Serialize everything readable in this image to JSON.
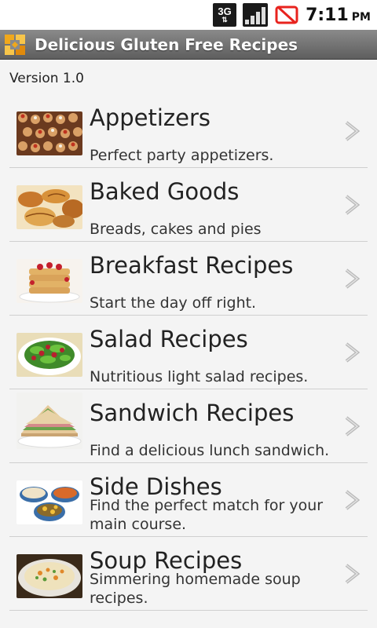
{
  "status_bar": {
    "network": "3G",
    "time": "7:11",
    "ampm": "PM"
  },
  "title_bar": {
    "title": "Delicious Gluten Free Recipes"
  },
  "version": "Version 1.0",
  "categories": [
    {
      "title": "Appetizers",
      "subtitle": "Perfect party appetizers."
    },
    {
      "title": "Baked Goods",
      "subtitle": "Breads, cakes and pies"
    },
    {
      "title": "Breakfast Recipes",
      "subtitle": "Start the day off right."
    },
    {
      "title": "Salad Recipes",
      "subtitle": "Nutritious light salad recipes."
    },
    {
      "title": "Sandwich Recipes",
      "subtitle": "Find a delicious lunch sandwich."
    },
    {
      "title": "Side Dishes",
      "subtitle": "Find the perfect match for your main course."
    },
    {
      "title": "Soup Recipes",
      "subtitle": "Simmering homemade soup recipes."
    }
  ],
  "colors": {
    "accent": "#f0a81c",
    "title_bar": "#6e6e6e",
    "no_signal": "#e8231e"
  }
}
